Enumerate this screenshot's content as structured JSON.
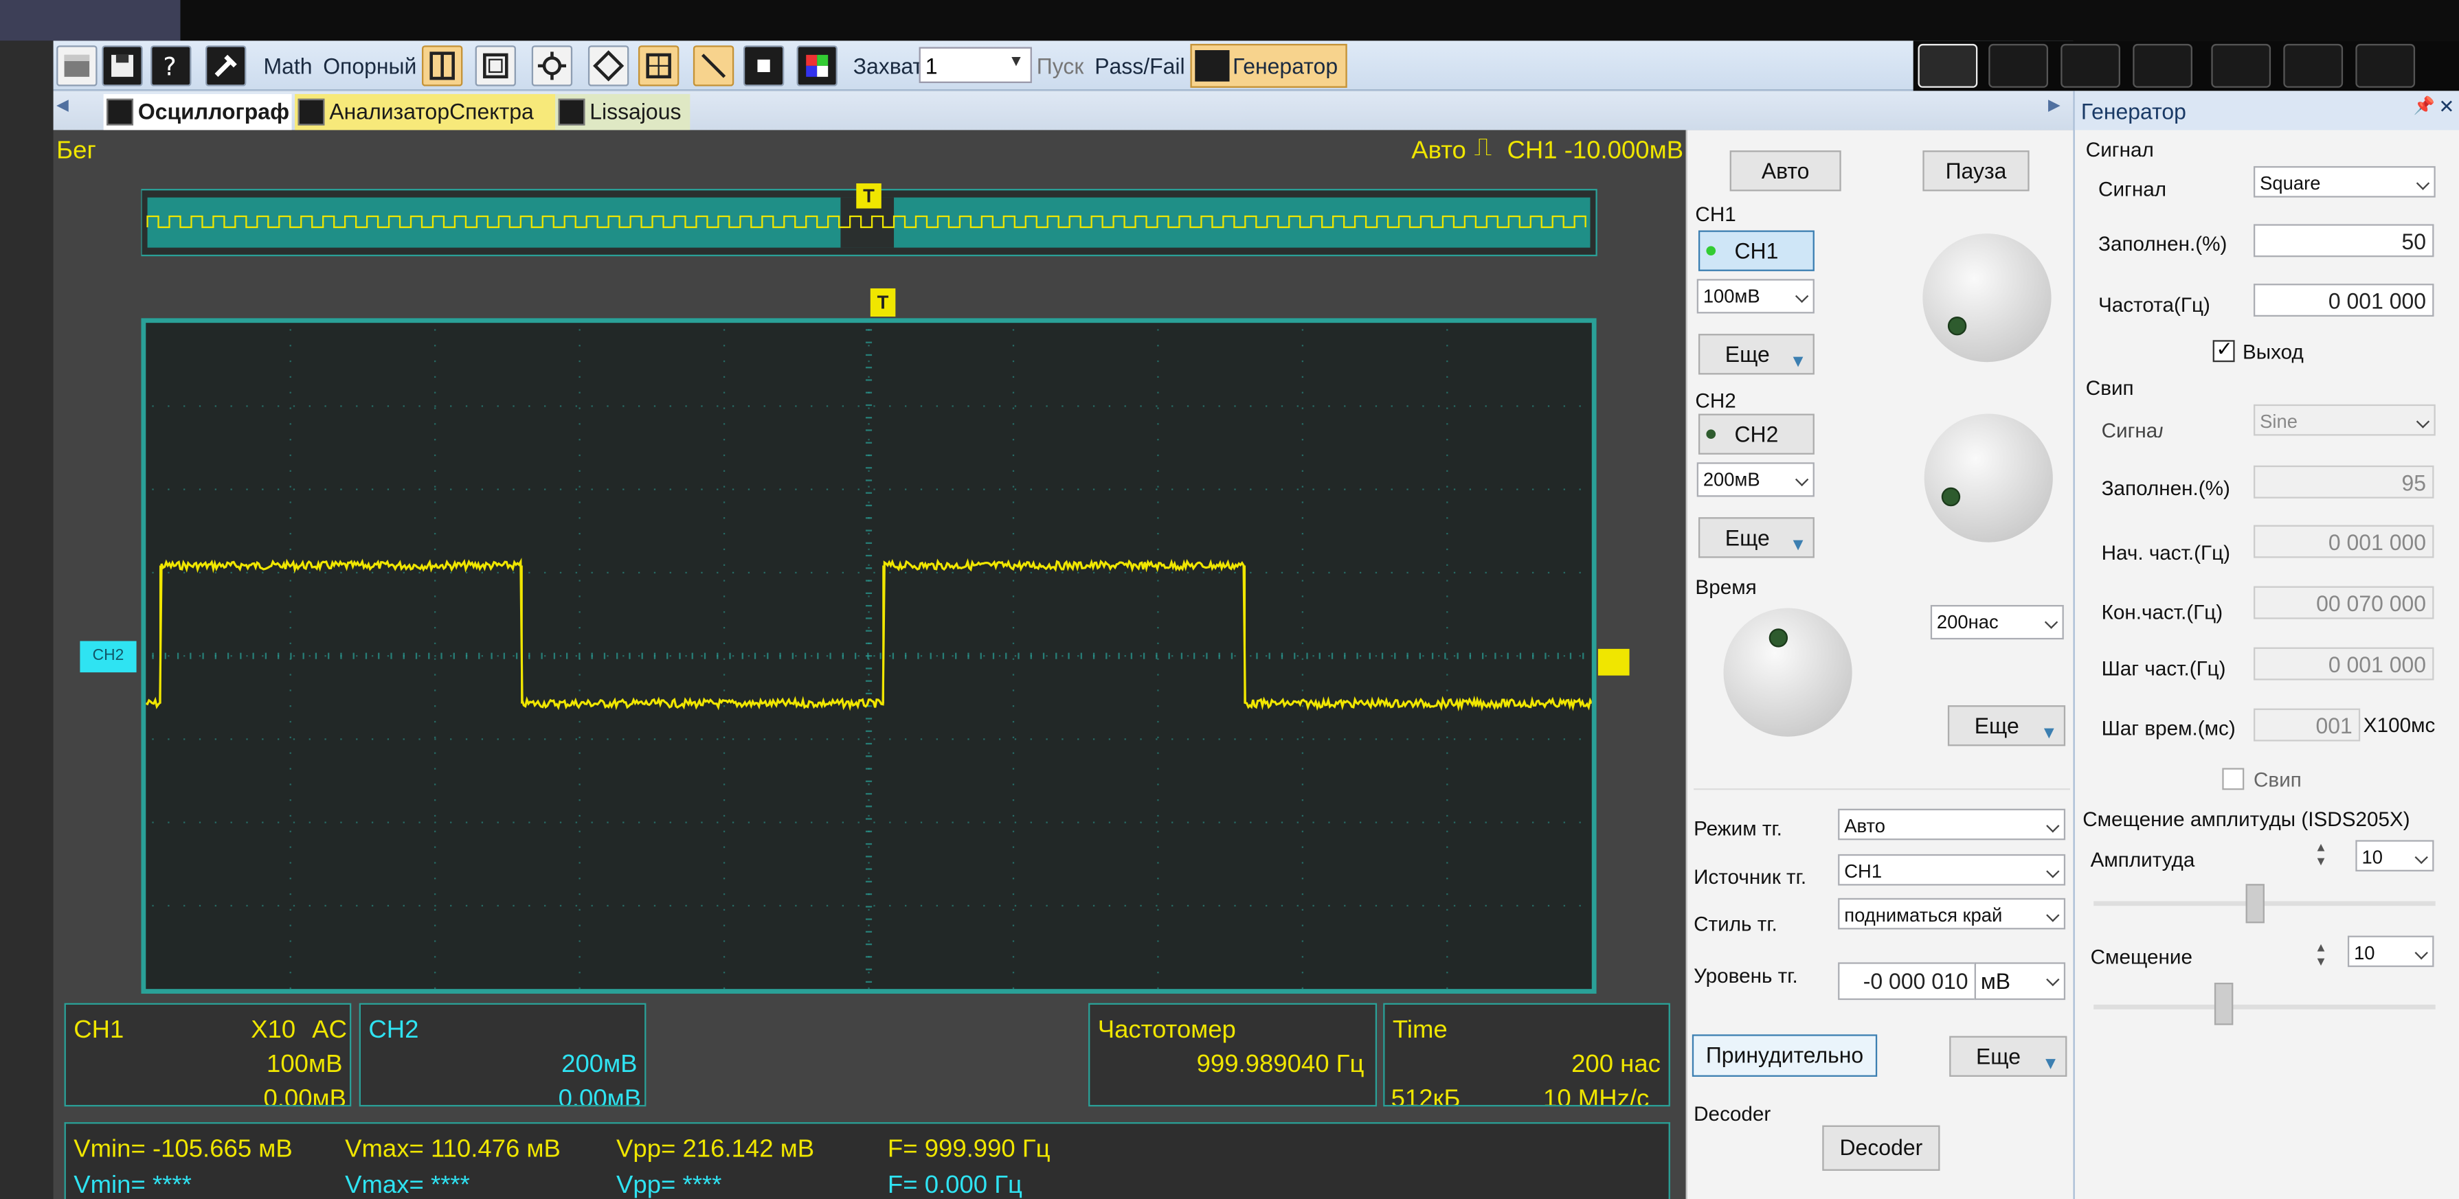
{
  "toolbar": {
    "math_label": "Math",
    "ref_label": "Опорный",
    "capture_label": "Захват",
    "capture_value": "1",
    "run_label": "Пуск",
    "passfail_label": "Pass/Fail",
    "generator_label": "Генератор"
  },
  "tabs": [
    "Осциллограф",
    "АнализаторСпектра",
    "Lissajous"
  ],
  "scope": {
    "status": "Бег",
    "trigger_mode": "Авто",
    "trigger_info": "CH1 -10.000мВ",
    "ch2_marker": "CH2",
    "trigger_marker": "T"
  },
  "info": {
    "ch1_name": "CH1",
    "ch1_probe": "X10",
    "ch1_coupling": "AC",
    "ch1_scale": "100мВ",
    "ch1_offset": "0.00мВ",
    "ch2_name": "CH2",
    "ch2_scale": "200мВ",
    "ch2_offset": "0.00мВ",
    "freq_label": "Частотомер",
    "freq_value": "999.989040 Гц",
    "time_label": "Time",
    "time_value": "200 нас",
    "time_mem": "512кБ",
    "time_rate": "10 МНz/с"
  },
  "measure": {
    "r1": [
      "Vmin= -105.665 мВ",
      "Vmax= 110.476 мВ",
      "Vpp= 216.142 мВ",
      "F= 999.990 Гц"
    ],
    "r2": [
      "Vmin= ****",
      "Vmax= ****",
      "Vpp= ****",
      "F= 0.000 Гц"
    ]
  },
  "control": {
    "auto": "Авто",
    "pause": "Пауза",
    "ch1_label": "CH1",
    "ch1_btn": "CH1",
    "ch1_volt": "100мВ",
    "more": "Еще",
    "ch2_label": "CH2",
    "ch2_btn": "CH2",
    "ch2_volt": "200мВ",
    "time_label": "Время",
    "time_value": "200нас",
    "trig_mode_label": "Режим тг.",
    "trig_mode": "Авто",
    "trig_src_label": "Источник тг.",
    "trig_src": "CH1",
    "trig_style_label": "Стиль тг.",
    "trig_style": "подниматься край",
    "trig_level_label": "Уровень тг.",
    "trig_level": "-0 000 010",
    "trig_unit": "мВ",
    "force": "Принудительно",
    "decoder_label": "Decoder",
    "decoder_btn": "Decoder"
  },
  "gen": {
    "title": "Генератор",
    "signal_group": "Сигнал",
    "signal_label": "Сигнал",
    "signal_value": "Square",
    "duty_label": "Заполнен.(%)",
    "duty_value": "50",
    "freq_label": "Частота(Гц)",
    "freq_value": "0 001 000",
    "output_label": "Выход",
    "sweep_group": "Свип",
    "s_signal_label": "Сигнал",
    "s_signal_value": "Sine",
    "s_duty_label": "Заполнен.(%)",
    "s_duty_value": "95",
    "s_start_label": "Нач. част.(Гц)",
    "s_start_value": "0 001 000",
    "s_end_label": "Кон.част.(Гц)",
    "s_end_value": "00 070 000",
    "s_step_label": "Шаг част.(Гц)",
    "s_step_value": "0 001 000",
    "s_time_label": "Шаг врем.(мс)",
    "s_time_value": "001",
    "s_time_unit": "X100мс",
    "sweep_chk": "Свип",
    "offset_group": "Смещение амплитуды (ISDS205X)",
    "amp_label": "Амплитуда",
    "amp_value": "10",
    "off_label": "Смещение",
    "off_value": "10"
  },
  "colors": {
    "trace": "#f0e600",
    "grid": "#2aa198",
    "ch2": "#2fe3f2"
  },
  "waveform": {
    "high_periods": [
      [
        0.01,
        0.26
      ],
      [
        0.51,
        0.76
      ]
    ],
    "level_high": 0.19,
    "level_low": -0.1
  }
}
